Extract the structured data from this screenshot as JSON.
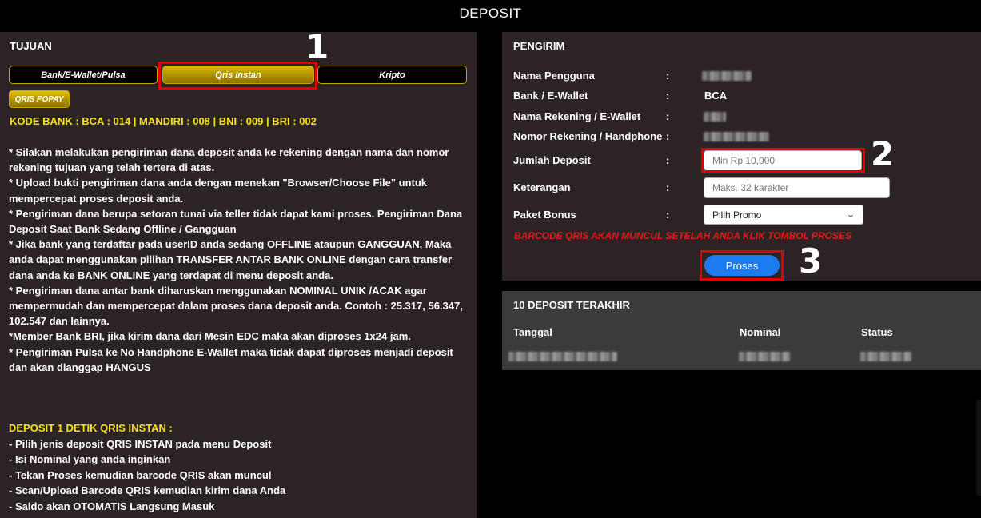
{
  "header": {
    "title": "DEPOSIT"
  },
  "tujuan": {
    "heading": "TUJUAN",
    "tabs": [
      {
        "label": "Bank/E-Wallet/Pulsa",
        "active": false
      },
      {
        "label": "Qris Instan",
        "active": true
      },
      {
        "label": "Kripto",
        "active": false
      }
    ],
    "qris_button": "QRIS POPAY",
    "bank_codes": "KODE BANK : BCA : 014 | MANDIRI : 008 | BNI : 009 | BRI : 002",
    "rules": [
      "* Silakan melakukan pengiriman dana deposit anda ke rekening dengan nama dan nomor rekening tujuan yang telah tertera di atas.",
      "* Upload bukti pengiriman dana anda dengan menekan \"Browser/Choose File\" untuk mempercepat proses deposit anda.",
      "* Pengiriman dana berupa setoran tunai via teller tidak dapat kami proses. Pengiriman Dana Deposit Saat Bank Sedang Offline / Gangguan",
      "* Jika bank yang terdaftar pada userID anda sedang OFFLINE ataupun GANGGUAN, Maka anda dapat menggunakan pilihan TRANSFER ANTAR BANK ONLINE dengan cara transfer dana anda ke BANK ONLINE yang terdapat di menu deposit anda.",
      "* Pengiriman dana antar bank diharuskan menggunakan NOMINAL UNIK /ACAK agar mempermudah dan mempercepat dalam proses dana deposit anda. Contoh : 25.317, 56.347, 102.547 dan lainnya.",
      "*Member Bank BRI, jika kirim dana dari Mesin EDC maka akan diproses 1x24 jam.",
      "* Pengiriman Pulsa ke No Handphone E-Wallet maka tidak dapat diproses menjadi deposit dan akan dianggap HANGUS"
    ],
    "qris_heading": "DEPOSIT 1 DETIK QRIS INSTAN :",
    "qris_steps": [
      "- Pilih jenis deposit QRIS INSTAN pada menu Deposit",
      "- Isi Nominal yang anda inginkan",
      "- Tekan Proses kemudian barcode QRIS akan muncul",
      "- Scan/Upload Barcode QRIS kemudian kirim dana Anda",
      "- Saldo akan OTOMATIS Langsung Masuk"
    ]
  },
  "pengirim": {
    "heading": "PENGIRIM",
    "fields": {
      "nama_pengguna": "Nama Pengguna",
      "bank": "Bank / E-Wallet",
      "bank_value": "BCA",
      "nama_rekening": "Nama Rekening / E-Wallet",
      "nomor_rekening": "Nomor Rekening / Handphone",
      "jumlah": "Jumlah Deposit",
      "jumlah_placeholder": "Min Rp 10,000",
      "keterangan": "Keterangan",
      "keterangan_placeholder": "Maks. 32 karakter",
      "paket": "Paket Bonus",
      "paket_value": "Pilih Promo"
    },
    "colon": ":",
    "barcode_notice": "BARCODE QRIS AKAN MUNCUL SETELAH ANDA KLIK TOMBOL PROSES",
    "submit": "Proses"
  },
  "history": {
    "heading": "10 DEPOSIT TERAKHIR",
    "columns": [
      "Tanggal",
      "Nominal",
      "Status"
    ]
  },
  "annotations": [
    "1",
    "2",
    "3"
  ],
  "colors": {
    "gold": "#d9b600",
    "yellow_text": "#f5e21a",
    "red": "#e21b1b",
    "blue": "#1a7cf0"
  }
}
